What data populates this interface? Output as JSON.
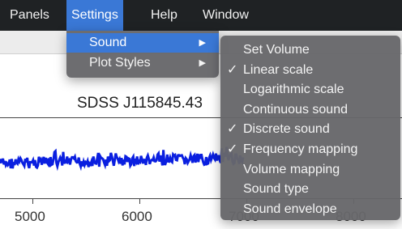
{
  "menubar": {
    "items": [
      "Panels",
      "Settings",
      "Help",
      "Window"
    ]
  },
  "settings_menu": {
    "items": [
      "Sound",
      "Plot Styles"
    ]
  },
  "sound_menu": {
    "items": [
      {
        "label": "Set Volume",
        "checked": false
      },
      {
        "label": "Linear scale",
        "checked": true
      },
      {
        "label": "Logarithmic scale",
        "checked": false
      },
      {
        "label": "Continuous sound",
        "checked": false
      },
      {
        "label": "Discrete sound",
        "checked": true
      },
      {
        "label": "Frequency mapping",
        "checked": true
      },
      {
        "label": "Volume mapping",
        "checked": false
      },
      {
        "label": "Sound type",
        "checked": false
      },
      {
        "label": "Sound envelope",
        "checked": false
      }
    ],
    "check_glyph": "✓"
  },
  "submenu_arrow": "▶",
  "plot": {
    "title": "SDSS J115845.43",
    "x_ticks": [
      "5000",
      "6000",
      "7000",
      "8000"
    ],
    "line_color": "#0a1fe0"
  }
}
